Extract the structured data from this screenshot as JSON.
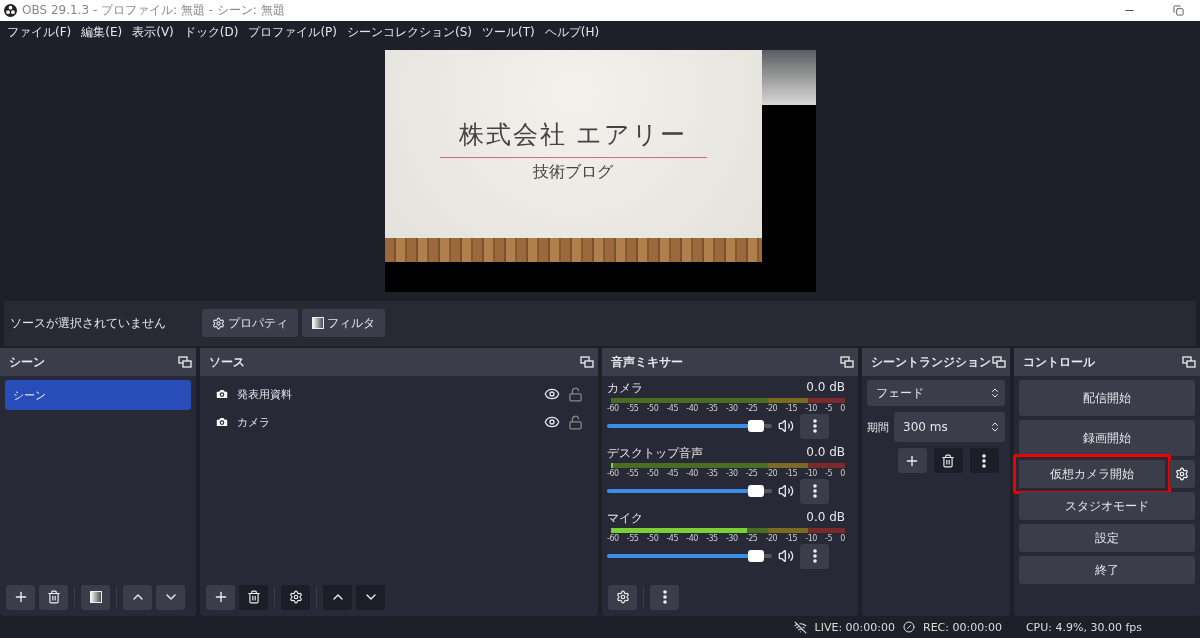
{
  "window": {
    "title": "OBS 29.1.3 - プロファイル: 無題 - シーン: 無題"
  },
  "menu": [
    "ファイル(F)",
    "編集(E)",
    "表示(V)",
    "ドック(D)",
    "プロファイル(P)",
    "シーンコレクション(S)",
    "ツール(T)",
    "ヘルプ(H)"
  ],
  "preview": {
    "slide": {
      "title": "株式会社 エアリー",
      "subtitle": "技術ブログ"
    }
  },
  "source_bar": {
    "status": "ソースが選択されていません",
    "buttons": [
      "プロパティ",
      "フィルタ"
    ]
  },
  "scenes": {
    "title": "シーン",
    "items": [
      {
        "label": "シーン",
        "selected": true
      }
    ]
  },
  "sources": {
    "title": "ソース",
    "items": [
      {
        "label": "発表用資料",
        "visible": true,
        "locked": false
      },
      {
        "label": "カメラ",
        "visible": true,
        "locked": false
      }
    ]
  },
  "mixer": {
    "title": "音声ミキサー",
    "channels": [
      {
        "name": "カメラ",
        "reading": "0.0 dB",
        "volume": {
          "level": 0.95
        },
        "scale": [
          "-60",
          "-55",
          "-50",
          "-45",
          "-40",
          "-35",
          "-30",
          "-25",
          "-20",
          "-15",
          "-10",
          "-5",
          "0"
        ]
      },
      {
        "name": "デスクトップ音声",
        "reading": "0.0 dB",
        "meter": {
          "level": 0.01
        },
        "volume": {
          "level": 0.95
        },
        "scale": [
          "-60",
          "-55",
          "-50",
          "-45",
          "-40",
          "-35",
          "-30",
          "-25",
          "-20",
          "-15",
          "-10",
          "-5",
          "0"
        ]
      },
      {
        "name": "マイク",
        "reading": "0.0 dB",
        "meter": {
          "level": 0.58
        },
        "volume": {
          "level": 0.95
        },
        "scale": [
          "-60",
          "-55",
          "-50",
          "-45",
          "-40",
          "-35",
          "-30",
          "-25",
          "-20",
          "-15",
          "-10",
          "-5",
          "0"
        ]
      }
    ]
  },
  "transitions": {
    "title": "シーントランジション",
    "transition": "フェード",
    "duration_label": "期間",
    "duration": "300 ms"
  },
  "controls": {
    "title": "コントロール",
    "buttons": [
      {
        "label": "配信開始",
        "highlighted": false,
        "has_settings": false
      },
      {
        "label": "録画開始",
        "highlighted": false,
        "has_settings": false
      },
      {
        "label": "仮想カメラ開始",
        "highlighted": true,
        "has_settings": true
      },
      {
        "label": "スタジオモード",
        "highlighted": false,
        "has_settings": false
      },
      {
        "label": "設定",
        "highlighted": false,
        "has_settings": false
      },
      {
        "label": "終了",
        "highlighted": false,
        "has_settings": false
      }
    ]
  },
  "status_bar": {
    "live": "LIVE: 00:00:00",
    "rec": "REC: 00:00:00",
    "cpu": "CPU: 4.9%, 30.00 fps"
  }
}
